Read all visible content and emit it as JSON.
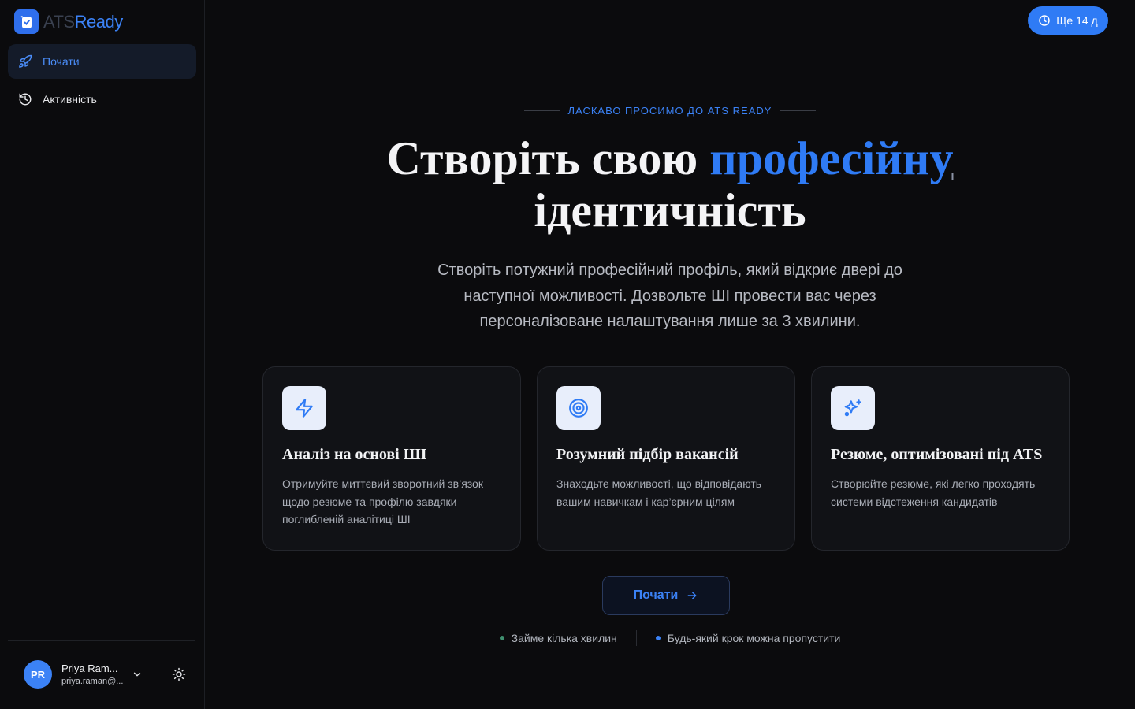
{
  "brand": {
    "ats": "ATS",
    "ready": "Ready"
  },
  "sidebar": {
    "items": [
      {
        "label": "Почати",
        "icon": "rocket-icon",
        "active": true
      },
      {
        "label": "Активність",
        "icon": "history-icon",
        "active": false
      }
    ]
  },
  "user": {
    "initials": "PR",
    "name": "Priya Ram...",
    "email": "priya.raman@..."
  },
  "trial": {
    "label": "Ще 14 д",
    "icon": "clock-icon"
  },
  "hero": {
    "eyebrow": "ЛАСКАВО ПРОСИМО ДО ATS READY",
    "title_before": "Створіть свою ",
    "title_highlight": "професійну",
    "title_after": "ідентичність",
    "subtitle": "Створіть потужний професійний профіль, який відкриє двері до наступної можливості. Дозвольте ШІ провести вас через персоналізоване налаштування лише за 3 хвилини."
  },
  "features": [
    {
      "icon": "zap-icon",
      "title": "Аналіз на основі ШІ",
      "desc": "Отримуйте миттєвий зворотний зв’язок щодо резюме та профілю завдяки поглибленій аналітиці ШІ"
    },
    {
      "icon": "target-icon",
      "title": "Розумний підбір вакансій",
      "desc": "Знаходьте можливості, що відповідають вашим навичкам і кар’єрним цілям"
    },
    {
      "icon": "sparkles-icon",
      "title": "Резюме, оптимізовані під ATS",
      "desc": "Створюйте резюме, які легко проходять системи відстеження кандидатів"
    }
  ],
  "cta": {
    "label": "Почати"
  },
  "footnotes": [
    {
      "text": "Займе кілька хвилин",
      "color": "#3f8f6f"
    },
    {
      "text": "Будь-який крок можна пропустити",
      "color": "#3b82f6"
    }
  ],
  "colors": {
    "accent": "#3b82f6",
    "background": "#0b0b0d",
    "card": "#111216"
  }
}
